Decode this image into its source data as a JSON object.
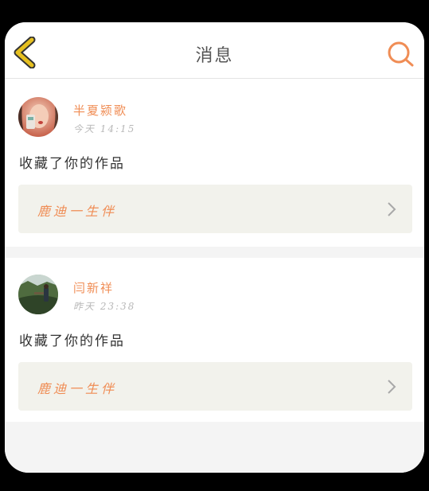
{
  "header": {
    "title": "消息",
    "back_icon": "back-chevron-icon",
    "search_icon": "search-icon",
    "accent_color": "#f08d55",
    "back_color": "#e6c020"
  },
  "messages": [
    {
      "username": "半夏颍歌",
      "time": "今天 14:15",
      "text": "收藏了你的作品",
      "work_title": "鹿迪一生伴",
      "avatar": "user-avatar-photo"
    },
    {
      "username": "闫新祥",
      "time": "昨天 23:38",
      "text": "收藏了你的作品",
      "work_title": "鹿迪一生伴",
      "avatar": "user-avatar-photo"
    }
  ]
}
